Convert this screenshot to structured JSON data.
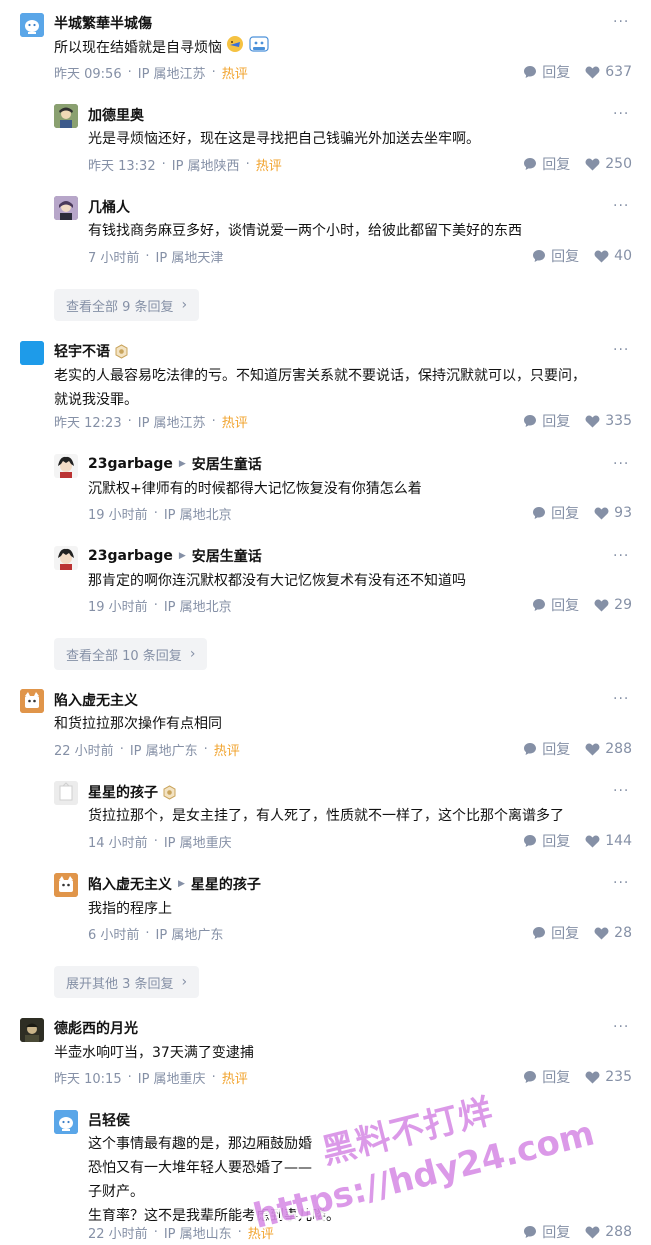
{
  "colors": {
    "hot": "#f1a32d",
    "meta": "#8590a6",
    "text": "#121212",
    "expand_bg": "#f2f3f5"
  },
  "threads": [
    {
      "comment": {
        "author": "半城繁華半城傷",
        "content": "所以现在结婚就是自寻烦恼",
        "time": "昨天 09:56",
        "ip": "IP 属地江苏",
        "hot": "热评",
        "reply": "回复",
        "likes": "637",
        "avatar_icon": "default-avatar-icon"
      },
      "replies": [
        {
          "author": "加德里奥",
          "content": "光是寻烦恼还好，现在这是寻找把自己钱骗光外加送去坐牢啊。",
          "time": "昨天 13:32",
          "ip": "IP 属地陕西",
          "hot": "热评",
          "reply": "回复",
          "likes": "250"
        },
        {
          "author": "几桶人",
          "content": "有钱找商务麻豆多好，谈情说爱一两个小时，给彼此都留下美好的东西",
          "time": "7 小时前",
          "ip": "IP 属地天津",
          "reply": "回复",
          "likes": "40"
        }
      ],
      "expand": "查看全部 9 条回复"
    },
    {
      "comment": {
        "author": "轻宇不语",
        "content_lines": [
          "老实的人最容易吃法律的亏。不知道厉害关系就不要说话，保持沉默就可以，只要问，",
          "就说我没罪。"
        ],
        "time": "昨天 12:23",
        "ip": "IP 属地江苏",
        "hot": "热评",
        "reply": "回复",
        "likes": "335"
      },
      "replies": [
        {
          "author": "23garbage",
          "reply_to": "安居生童话",
          "content": "沉默权+律师有的时候都得大记忆恢复没有你猜怎么着",
          "time": "19 小时前",
          "ip": "IP 属地北京",
          "reply": "回复",
          "likes": "93"
        },
        {
          "author": "23garbage",
          "reply_to": "安居生童话",
          "content": "那肯定的啊你连沉默权都没有大记忆恢复术有没有还不知道吗",
          "time": "19 小时前",
          "ip": "IP 属地北京",
          "reply": "回复",
          "likes": "29"
        }
      ],
      "expand": "查看全部 10 条回复"
    },
    {
      "comment": {
        "author": "陷入虚无主义",
        "content": "和货拉拉那次操作有点相同",
        "time": "22 小时前",
        "ip": "IP 属地广东",
        "hot": "热评",
        "reply": "回复",
        "likes": "288"
      },
      "replies": [
        {
          "author": "星星的孩子",
          "content": "货拉拉那个，是女主挂了，有人死了，性质就不一样了，这个比那个离谱多了",
          "time": "14 小时前",
          "ip": "IP 属地重庆",
          "reply": "回复",
          "likes": "144"
        },
        {
          "author": "陷入虚无主义",
          "reply_to": "星星的孩子",
          "content": "我指的程序上",
          "time": "6 小时前",
          "ip": "IP 属地广东",
          "reply": "回复",
          "likes": "28"
        }
      ],
      "expand": "展开其他 3 条回复"
    },
    {
      "comment": {
        "author": "德彪西的月光",
        "content": "半壶水响叮当，37天满了变逮捕",
        "time": "昨天 10:15",
        "ip": "IP 属地重庆",
        "hot": "热评",
        "reply": "回复",
        "likes": "235"
      },
      "replies": [
        {
          "author": "吕轻侯",
          "content_lines": [
            "这个事情最有趣的是，那边厢鼓励婚",
            "恐怕又有一大堆年轻人要恐婚了——",
            "子财产。",
            "生育率？这不是我辈所能考虑到事儿喽。"
          ],
          "time": "22 小时前",
          "ip": "IP 属地山东",
          "hot": "热评",
          "reply": "回复",
          "likes": "288"
        }
      ]
    }
  ],
  "watermark": {
    "line1": "黑料不打烊",
    "line2": "https://hdy24.com"
  }
}
